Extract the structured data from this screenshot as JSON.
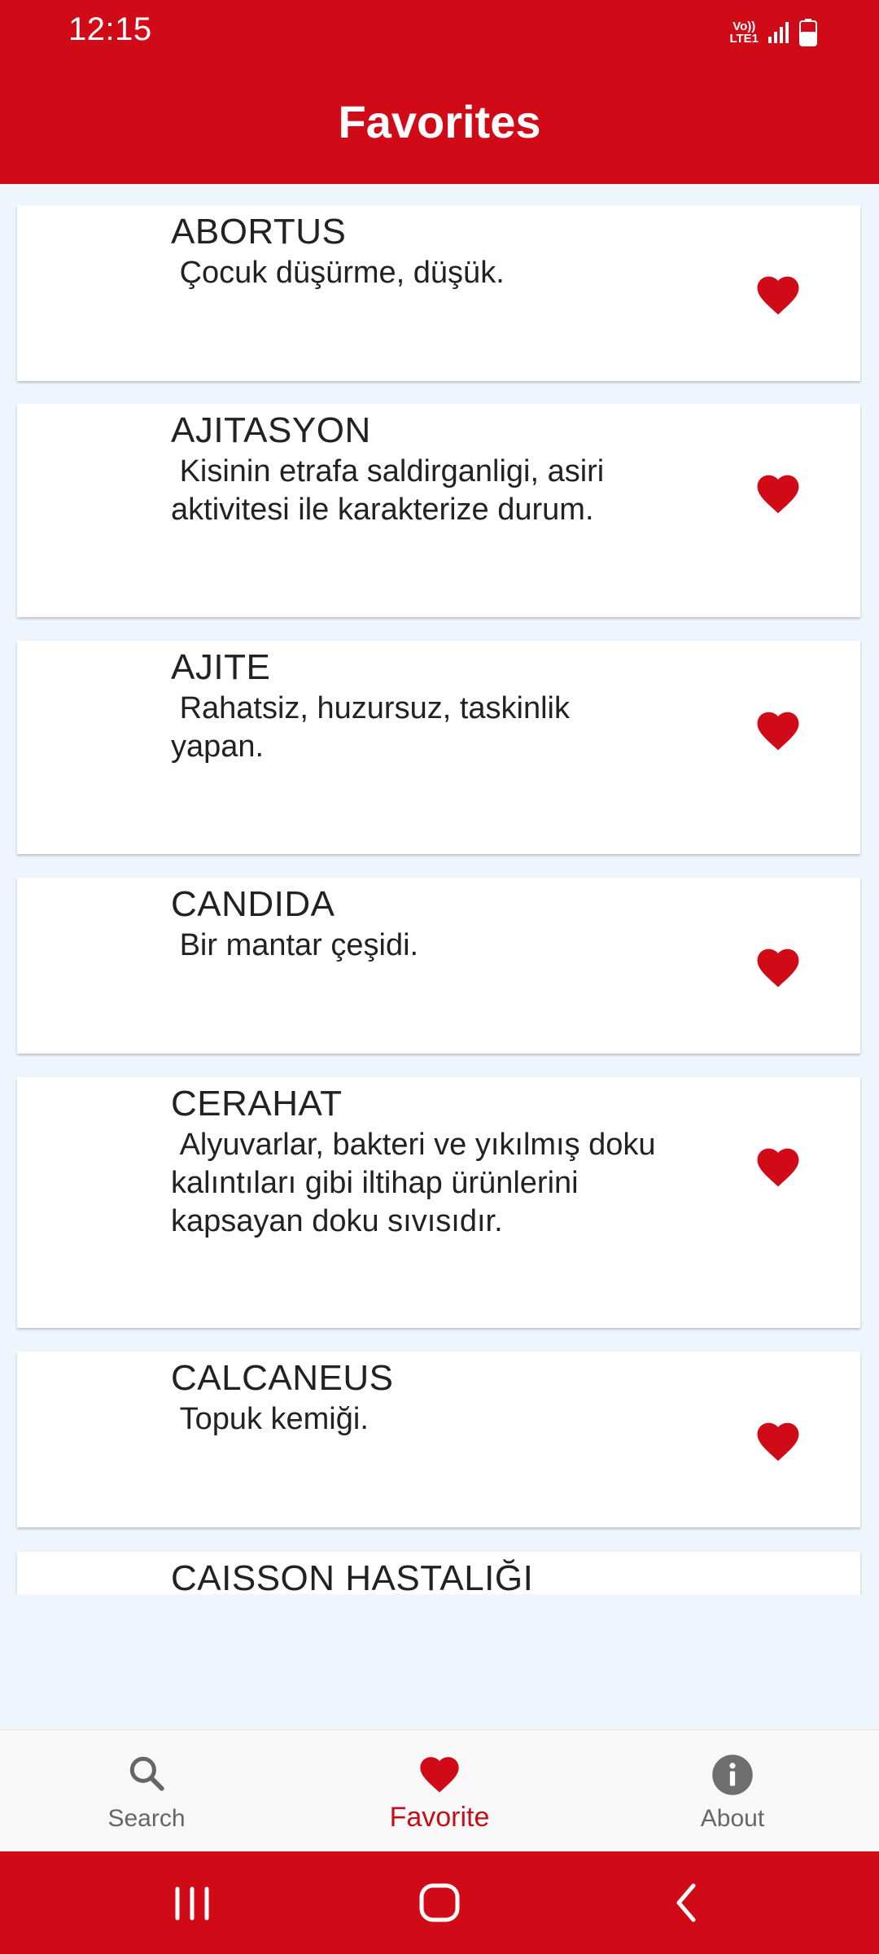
{
  "status_bar": {
    "time": "12:15",
    "network_top": "Vo))",
    "network_bottom": "LTE1"
  },
  "app_bar": {
    "title": "Favorites"
  },
  "favorites": [
    {
      "term": "ABORTUS",
      "definition": " Çocuk düşürme, düşük."
    },
    {
      "term": "AJITASYON",
      "definition": " Kisinin etrafa saldirganligi, asiri\naktivitesi ile karakterize durum."
    },
    {
      "term": "AJITE",
      "definition": " Rahatsiz, huzursuz, taskinlik\nyapan."
    },
    {
      "term": "CANDIDA",
      "definition": " Bir mantar çeşidi."
    },
    {
      "term": "CERAHAT",
      "definition": " Alyuvarlar, bakteri ve yıkılmış doku\nkalıntıları gibi iltihap ürünlerini\nkapsayan doku sıvısıdır."
    },
    {
      "term": "CALCANEUS",
      "definition": " Topuk kemiği."
    },
    {
      "term": "CAISSON HASTALIĞI",
      "definition": ""
    }
  ],
  "bottom_nav": {
    "search_label": "Search",
    "favorite_label": "Favorite",
    "about_label": "About",
    "active": "Favorite"
  },
  "colors": {
    "primary": "#d00a17",
    "heart": "#d00a17",
    "background": "#eff5fd",
    "inactive": "#666666"
  }
}
